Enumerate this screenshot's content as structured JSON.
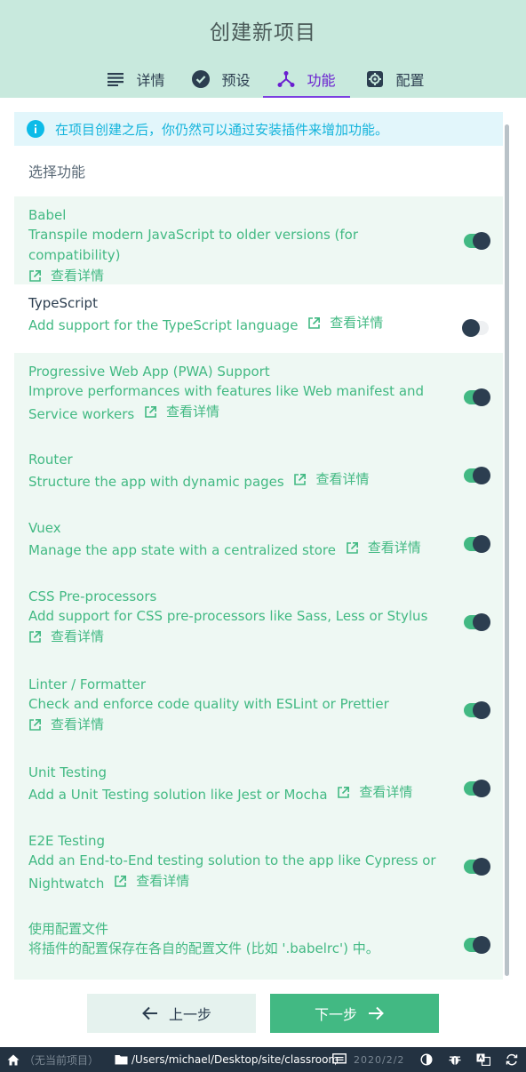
{
  "header": {
    "title": "创建新项目",
    "tabs": [
      {
        "label": "详情",
        "icon": "list-icon"
      },
      {
        "label": "预设",
        "icon": "check-circle-icon"
      },
      {
        "label": "功能",
        "icon": "fork-icon",
        "active": true
      },
      {
        "label": "配置",
        "icon": "settings-icon"
      }
    ]
  },
  "info": {
    "text": "在项目创建之后，你仍然可以通过安装插件来增加功能。"
  },
  "section_title": "选择功能",
  "more_label": "查看详情",
  "features": [
    {
      "name": "Babel",
      "desc": "Transpile modern JavaScript to older versions (for compatibility)",
      "enabled": true
    },
    {
      "name": "TypeScript",
      "desc": "Add support for the TypeScript language",
      "enabled": false
    },
    {
      "name": "Progressive Web App (PWA) Support",
      "desc": "Improve performances with features like Web manifest and Service workers",
      "enabled": true
    },
    {
      "name": "Router",
      "desc": "Structure the app with dynamic pages",
      "enabled": true
    },
    {
      "name": "Vuex",
      "desc": "Manage the app state with a centralized store",
      "enabled": true
    },
    {
      "name": "CSS Pre-processors",
      "desc": "Add support for CSS pre-processors like Sass, Less or Stylus",
      "enabled": true
    },
    {
      "name": "Linter / Formatter",
      "desc": "Check and enforce code quality with ESLint or Prettier",
      "enabled": true
    },
    {
      "name": "Unit Testing",
      "desc": "Add a Unit Testing solution like Jest or Mocha",
      "enabled": true
    },
    {
      "name": "E2E Testing",
      "desc": "Add an End-to-End testing solution to the app like Cypress or Nightwatch",
      "enabled": true
    },
    {
      "name": "使用配置文件",
      "desc": "将插件的配置保存在各自的配置文件 (比如 '.babelrc') 中。",
      "enabled": true
    }
  ],
  "buttons": {
    "prev": "上一步",
    "next": "下一步"
  },
  "statusbar": {
    "project": "（无当前项目）",
    "path": "/Users/michael/Desktop/site/classroom",
    "date": "2020/2/2"
  },
  "colors": {
    "accent": "#42b983",
    "header_bg": "#c8e9dd",
    "active_tab": "#6a1fd0",
    "info": "#14b4dc"
  }
}
